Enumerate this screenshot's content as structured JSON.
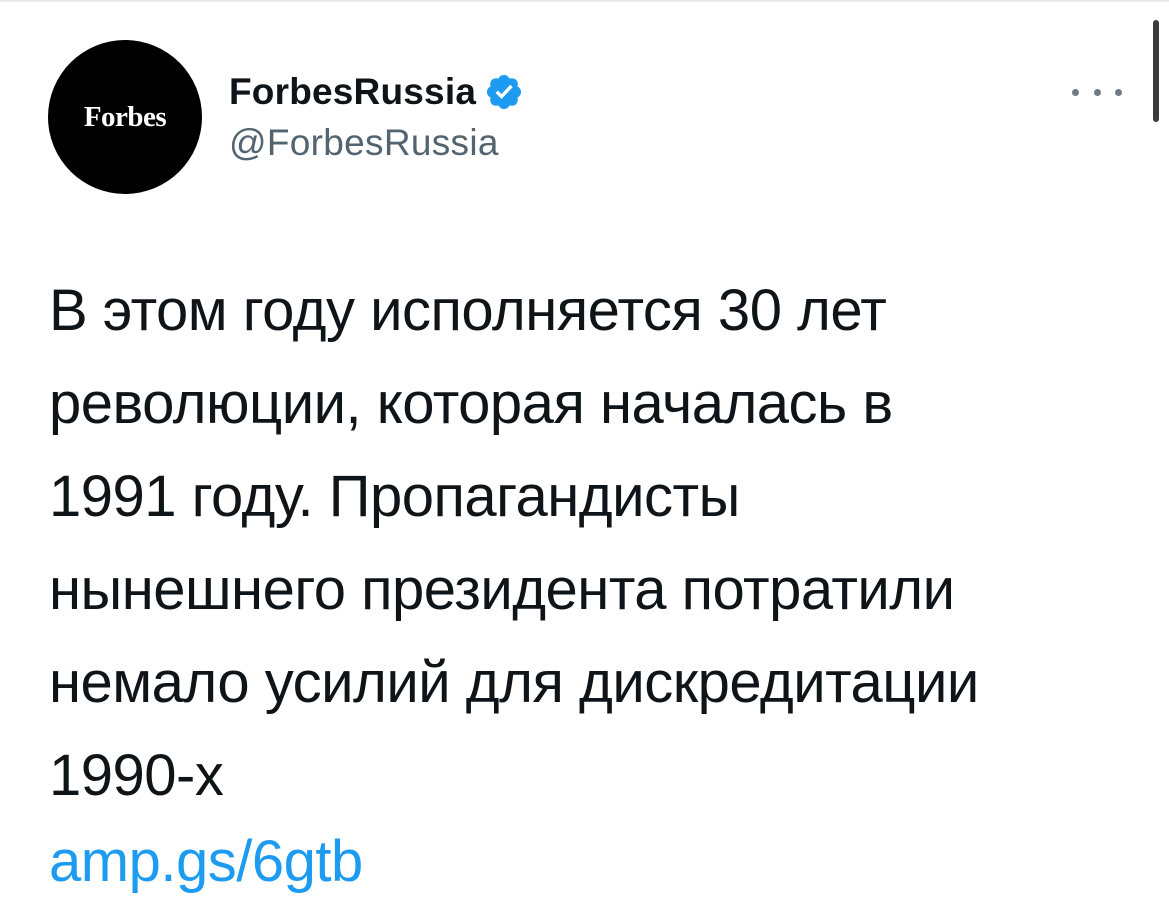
{
  "author": {
    "avatar_text": "Forbes",
    "display_name": "ForbesRussia",
    "username": "@ForbesRussia",
    "verified_icon": "verified-badge-icon"
  },
  "actions": {
    "more_icon": "more-horizontal-icon"
  },
  "tweet": {
    "lines": [
      "В этом году исполняется 30 лет",
      "революции, которая началась в",
      "1991 году. Пропагандисты",
      "нынешнего президента потратили",
      "немало усилий для дискредитации",
      "1990-х"
    ],
    "link": "amp.gs/6gtb"
  },
  "colors": {
    "text": "#0f1419",
    "secondary_text": "#536471",
    "link": "#1d9bf0",
    "verified": "#1d9bf0",
    "avatar_bg": "#000000"
  }
}
